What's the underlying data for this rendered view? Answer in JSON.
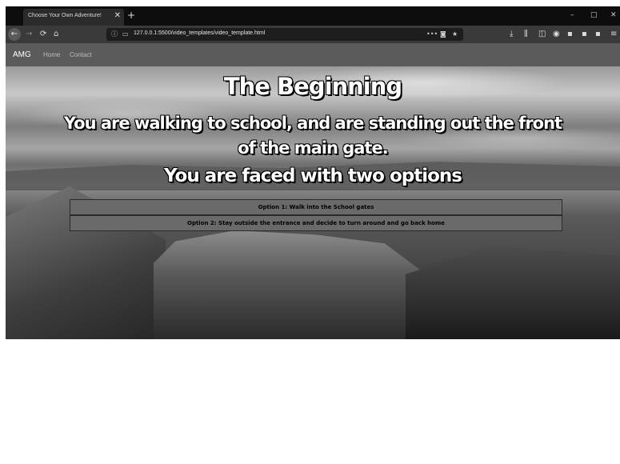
{
  "browser": {
    "tab_title": "Choose Your Own Adventure!",
    "tab_close": "✕",
    "new_tab": "+",
    "url": "127.0.0.1:5500/video_templates/video_template.html",
    "window_controls": {
      "minimize": "–",
      "maximize": "□",
      "close": "✕"
    },
    "icons": {
      "back": "←",
      "forward": "→",
      "reload": "⟳",
      "home": "⌂",
      "info": "ⓘ",
      "page": "▭",
      "more": "•••",
      "pocket": "◙",
      "star": "★",
      "download": "⤓",
      "library": "⫼",
      "sidebar": "◫",
      "account": "◉",
      "extension": "▪",
      "menu": "≡"
    }
  },
  "site_nav": {
    "brand": "AMG",
    "links": [
      "Home",
      "Contact"
    ]
  },
  "hero": {
    "title": "The Beginning",
    "subtitle": "You are walking to school, and are standing out the front of the main gate.",
    "prompt": "You are faced with two options",
    "options": [
      "Option 1: Walk into the School gates",
      "Option 2: Stay outside the entrance and decide to turn around and go back home"
    ]
  }
}
